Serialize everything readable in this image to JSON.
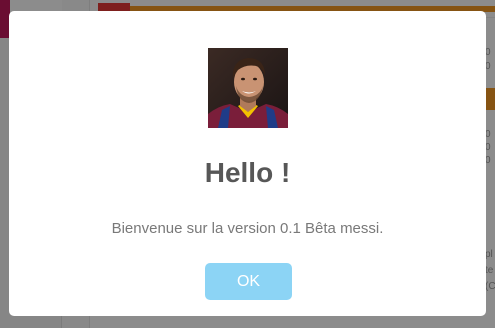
{
  "dialog": {
    "title": "Hello !",
    "message": "Bienvenue sur la version 0.1 Bêta messi.",
    "ok_label": "OK",
    "avatar": "messi-portrait-photo"
  },
  "background": {
    "side_fragments": [
      "0",
      "0",
      "0",
      "0",
      "0",
      "pl",
      "te",
      "(C"
    ]
  },
  "colors": {
    "overlay": "#000000",
    "button": "#8cd4f5",
    "title": "#575757",
    "message": "#797979",
    "accent_orange": "#f59a23",
    "accent_red": "#e53935"
  }
}
